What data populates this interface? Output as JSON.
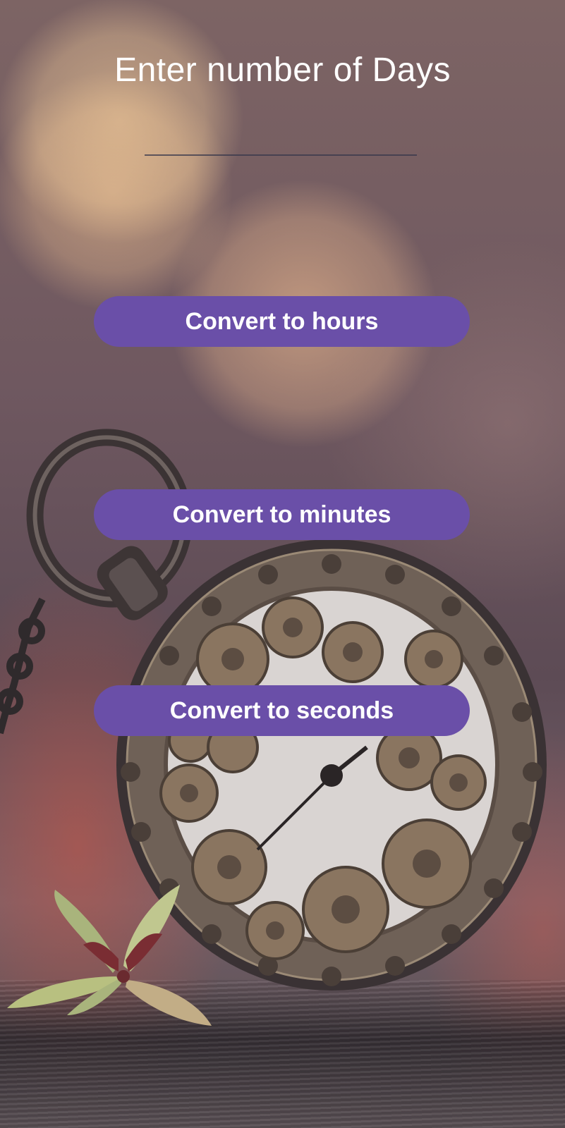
{
  "header": {
    "title": "Enter number of Days"
  },
  "days_input": {
    "value": "",
    "placeholder": ""
  },
  "actions": {
    "hours_label": "Convert to hours",
    "minutes_label": "Convert to minutes",
    "seconds_label": "Convert to seconds"
  },
  "background": {
    "image": "pocket-watch-photo"
  },
  "colors": {
    "button": "#6a4fa8",
    "button_text": "#ffffff",
    "title_text": "#ffffff"
  }
}
